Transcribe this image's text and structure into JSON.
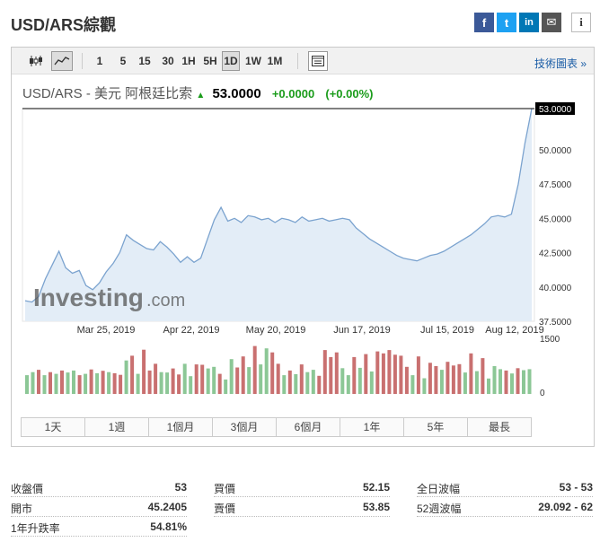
{
  "header": {
    "title": "USD/ARS綜觀"
  },
  "share": {
    "facebook": "f",
    "twitter": "t",
    "linkedin": "in",
    "email": "✉",
    "info": "i"
  },
  "toolbar": {
    "intervals": [
      "1",
      "5",
      "15",
      "30",
      "1H",
      "5H",
      "1D",
      "1W",
      "1M"
    ],
    "selected_interval": "1D",
    "tech_chart_link": "技術圖表 »"
  },
  "quote": {
    "name": "USD/ARS - 美元 阿根廷比索",
    "price": "53.0000",
    "change": "+0.0000",
    "change_pct": "(+0.00%)",
    "arrow": "▲"
  },
  "chart_data": {
    "type": "area",
    "watermark": "Investing.com",
    "y_ticks": [
      "53.0000",
      "50.0000",
      "47.5000",
      "45.0000",
      "42.5000",
      "40.0000",
      "37.5000"
    ],
    "ylim": [
      37.5,
      53.0
    ],
    "current_value_label": "53.0000",
    "current_value": 53.0,
    "x_ticks": [
      "Mar 25, 2019",
      "Apr 22, 2019",
      "May 20, 2019",
      "Jun 17, 2019",
      "Jul 15, 2019",
      "Aug 12, 2019"
    ],
    "values": [
      39.0,
      38.9,
      39.3,
      40.6,
      41.6,
      42.6,
      41.4,
      41.0,
      41.2,
      40.1,
      39.8,
      40.3,
      41.1,
      41.7,
      42.5,
      43.8,
      43.4,
      43.1,
      42.8,
      42.7,
      43.3,
      42.9,
      42.4,
      41.8,
      42.2,
      41.8,
      42.1,
      43.5,
      44.9,
      45.8,
      44.8,
      45.0,
      44.7,
      45.2,
      45.1,
      44.9,
      45.0,
      44.7,
      45.0,
      44.9,
      44.7,
      45.1,
      44.8,
      44.9,
      45.0,
      44.8,
      44.9,
      45.0,
      44.9,
      44.3,
      43.9,
      43.5,
      43.2,
      42.9,
      42.6,
      42.3,
      42.1,
      42.0,
      41.9,
      42.1,
      42.3,
      42.4,
      42.6,
      42.9,
      43.2,
      43.5,
      43.8,
      44.2,
      44.6,
      45.1,
      45.2,
      45.1,
      45.3,
      47.5,
      50.5,
      53.0
    ],
    "volume_ticks": [
      "1500",
      "0"
    ],
    "volume": {
      "values": [
        560,
        650,
        720,
        560,
        650,
        600,
        700,
        640,
        700,
        560,
        600,
        730,
        620,
        690,
        650,
        620,
        570,
        1000,
        1140,
        600,
        1320,
        700,
        900,
        650,
        640,
        760,
        580,
        900,
        530,
        880,
        870,
        760,
        810,
        600,
        430,
        1040,
        790,
        1120,
        800,
        1430,
        880,
        1360,
        1240,
        900,
        560,
        700,
        590,
        880,
        650,
        720,
        540,
        1310,
        1100,
        1240,
        770,
        560,
        1100,
        780,
        1190,
        670,
        1270,
        1210,
        1310,
        1170,
        1140,
        810,
        560,
        1120,
        470,
        930,
        830,
        720,
        960,
        850,
        890,
        640,
        1210,
        680,
        1070,
        460,
        830,
        740,
        700,
        610,
        770,
        710,
        740
      ],
      "colors": [
        "green",
        "green",
        "red",
        "green",
        "red",
        "green",
        "red",
        "green",
        "green",
        "red",
        "green",
        "red",
        "green",
        "red",
        "green",
        "red",
        "red",
        "green",
        "red",
        "green",
        "red",
        "red",
        "red",
        "green",
        "green",
        "red",
        "red",
        "green",
        "green",
        "red",
        "red",
        "green",
        "green",
        "red",
        "green",
        "green",
        "red",
        "red",
        "green",
        "red",
        "green",
        "green",
        "red",
        "red",
        "green",
        "red",
        "green",
        "red",
        "green",
        "green",
        "red",
        "red",
        "red",
        "red",
        "green",
        "green",
        "red",
        "green",
        "red",
        "green",
        "red",
        "red",
        "red",
        "red",
        "red",
        "red",
        "green",
        "red",
        "green",
        "red",
        "red",
        "green",
        "red",
        "red",
        "red",
        "green",
        "red",
        "green",
        "red",
        "green",
        "green",
        "green",
        "red",
        "green",
        "red",
        "green",
        "green"
      ]
    }
  },
  "colors": {
    "up": "#1b9c1b",
    "vol_green": "#8cc796",
    "vol_red": "#c97070",
    "area_fill": "#e3edf7",
    "area_line": "#7ba3cf",
    "link": "#1a5da6"
  },
  "ranges": [
    "1天",
    "1週",
    "1個月",
    "3個月",
    "6個月",
    "1年",
    "5年",
    "最長"
  ],
  "stats": {
    "prev_close": {
      "label": "收盤價",
      "value": "53"
    },
    "open": {
      "label": "開市",
      "value": "45.2405"
    },
    "one_year_change": {
      "label": "1年升跌率",
      "value": "54.81%"
    },
    "bid": {
      "label": "買價",
      "value": "52.15"
    },
    "ask": {
      "label": "賣價",
      "value": "53.85"
    },
    "day_range": {
      "label": "全日波幅",
      "value": "53 - 53"
    },
    "week52_range": {
      "label": "52週波幅",
      "value": "29.092 - 62"
    }
  }
}
